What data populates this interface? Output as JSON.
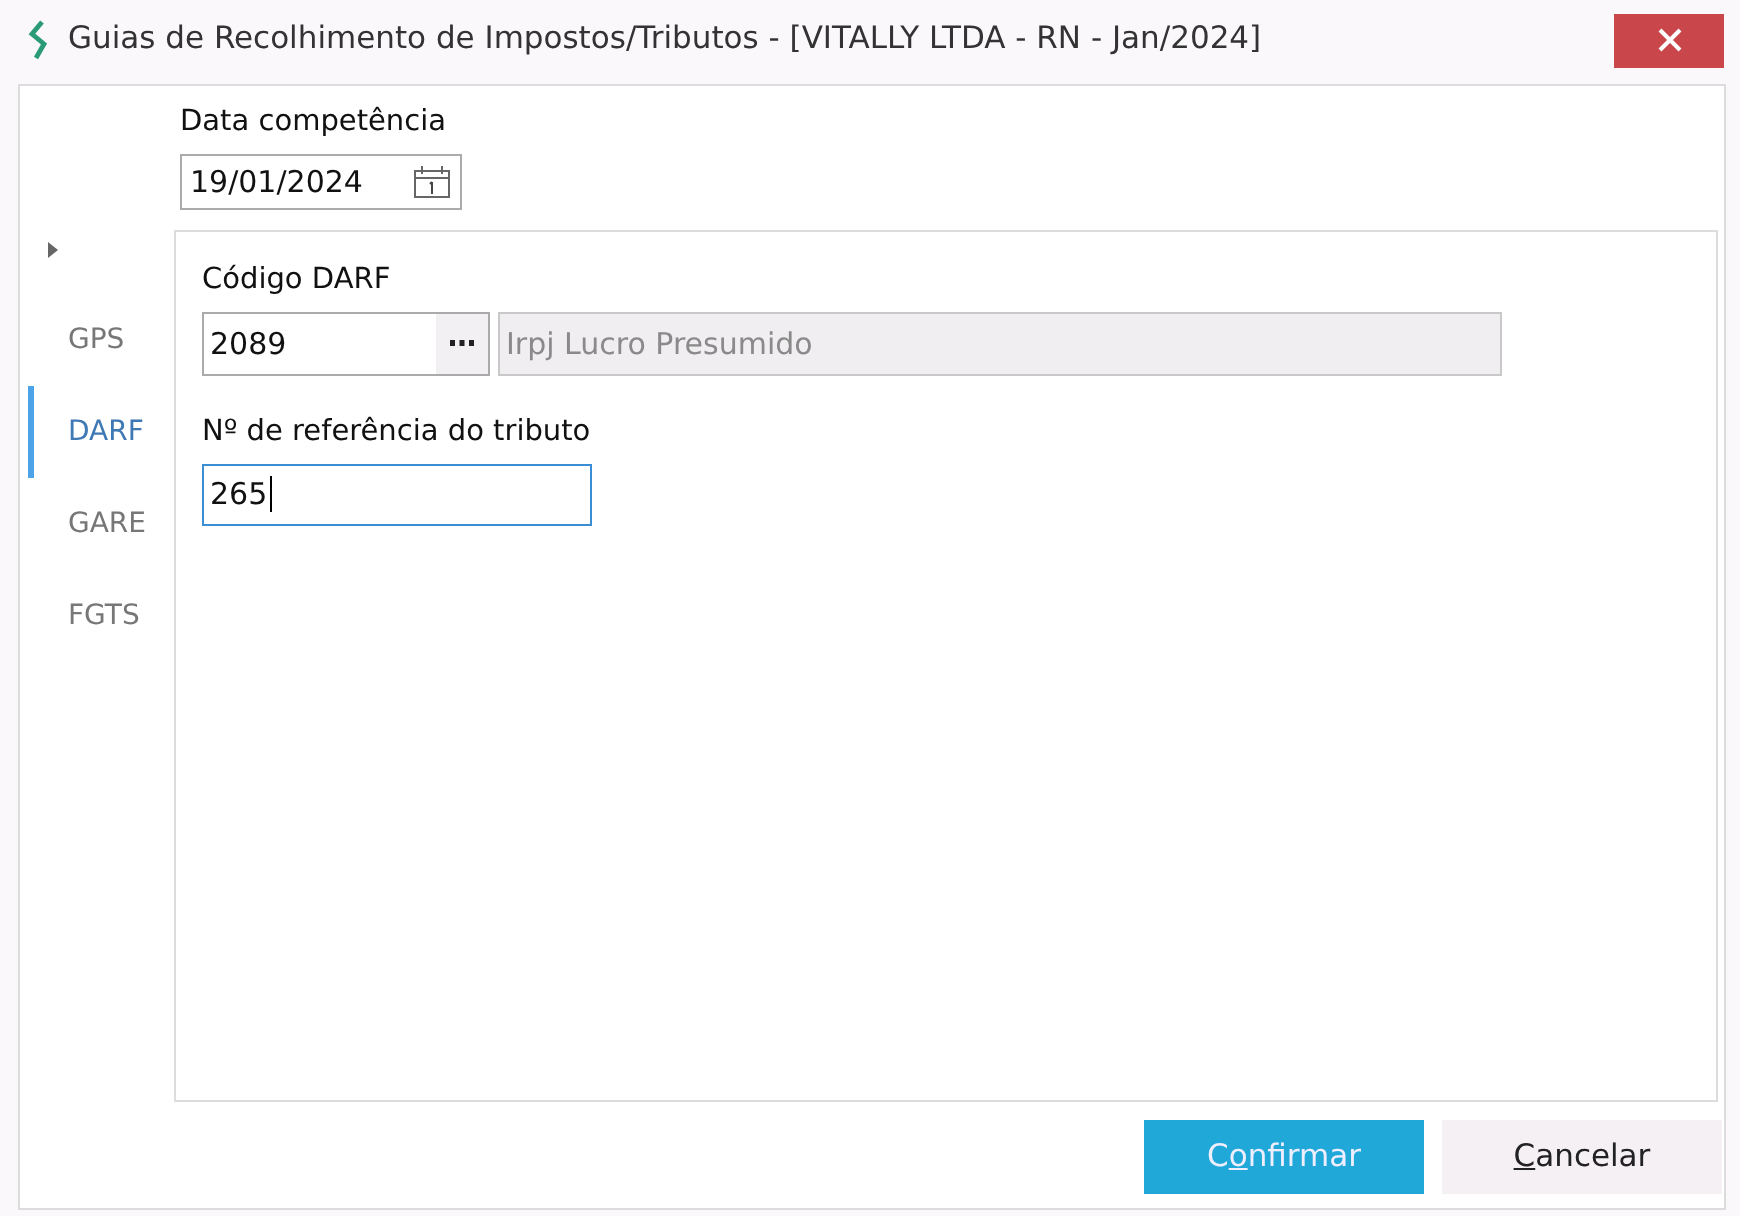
{
  "window": {
    "title": "Guias de Recolhimento de Impostos/Tributos -  [VITALLY LTDA - RN - Jan/2024]"
  },
  "date_field": {
    "label": "Data competência",
    "value": "19/01/2024"
  },
  "tabs": [
    {
      "label": "GPS",
      "selected": false
    },
    {
      "label": "DARF",
      "selected": true
    },
    {
      "label": "GARE",
      "selected": false
    },
    {
      "label": "FGTS",
      "selected": false
    }
  ],
  "darf": {
    "code_label": "Código DARF",
    "code_value": "2089",
    "code_description": "Irpj Lucro Presumido",
    "reference_label": "Nº de referência do tributo",
    "reference_value": "265"
  },
  "buttons": [
    {
      "kind": "primary",
      "before": "C",
      "mnemonic": "o",
      "after": "nfirmar"
    },
    {
      "kind": "secondary",
      "mnemonic": "C",
      "after": "ancelar"
    }
  ]
}
